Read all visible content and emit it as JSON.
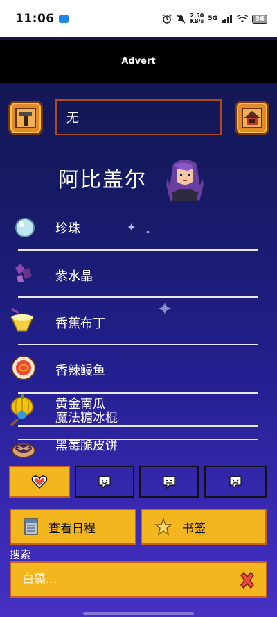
{
  "status_bar": {
    "time": "11:06",
    "net_speed_value": "2.50",
    "net_speed_unit": "KB/s",
    "network": "5G",
    "battery": "36"
  },
  "advert": {
    "label": "Advert"
  },
  "top_bar": {
    "left_icon": "hammer-icon",
    "right_icon": "house-icon",
    "npc_field_value": "无"
  },
  "villager": {
    "name": "阿比盖尔",
    "portrait_icon": "abigail-portrait"
  },
  "gifts": [
    {
      "label": "珍珠",
      "icon": "pearl-icon"
    },
    {
      "label": "紫水晶",
      "icon": "amethyst-icon"
    },
    {
      "label": "香蕉布丁",
      "icon": "banana-pudding-icon"
    },
    {
      "label": "香辣鳗鱼",
      "icon": "spicy-eel-icon"
    },
    {
      "label": "黄金南瓜",
      "icon": "golden-pumpkin-icon"
    },
    {
      "label": "魔法糖冰棍",
      "icon": "magic-rock-candy-icon"
    },
    {
      "label": "黑莓脆皮饼",
      "icon": "blackberry-cobbler-icon"
    }
  ],
  "tabs": [
    {
      "icon": "heart-loved-icon",
      "active": true
    },
    {
      "icon": "face-liked-icon",
      "active": false
    },
    {
      "icon": "face-neutral-icon",
      "active": false
    },
    {
      "icon": "face-disliked-icon",
      "active": false
    }
  ],
  "buttons": {
    "schedule_label": "查看日程",
    "schedule_icon": "calendar-icon",
    "bookmark_label": "书签",
    "bookmark_icon": "star-icon"
  },
  "search": {
    "label": "搜索",
    "placeholder": "白藻...",
    "clear_icon": "close-icon"
  },
  "colors": {
    "accent_yellow": "#f3b61f",
    "accent_border": "#c8601a",
    "background_top": "#12164a",
    "background_bottom": "#4530c3"
  }
}
